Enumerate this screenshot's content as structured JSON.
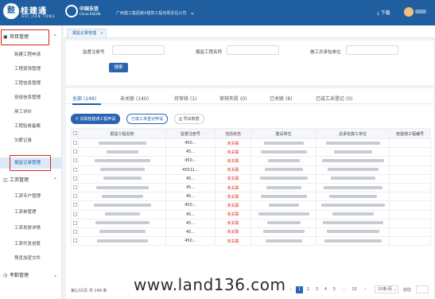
{
  "header": {
    "logo_mark": "鼓",
    "logo_title": "桂建通",
    "logo_subtitle": "GUI JIAN TONG",
    "partner_title": "中国东信",
    "partner_subtitle": "China-ASEAN",
    "org_selector": "广西建工集团第X建筑工程有限责任公司",
    "download_label": "下载"
  },
  "sidebar": {
    "groups": [
      {
        "label": "项目管理",
        "items": [
          "新建工程申请",
          "工程现场管理",
          "工程信息管理",
          "班组信息管理",
          "用工评价",
          "工程验收备案",
          "欠薪记录",
          "报监记录管理"
        ]
      },
      {
        "label": "工资管理",
        "items": [
          "工资专户管理",
          "工资单管理",
          "工资发放详情",
          "工资代发进度",
          "预览加密文件"
        ]
      },
      {
        "label": "考勤管理",
        "items": []
      }
    ],
    "active_item": "报监记录管理"
  },
  "tabs": [
    {
      "label": "报监记录管理"
    }
  ],
  "filter": {
    "fields": [
      {
        "label": "监督注册号",
        "value": ""
      },
      {
        "label": "报监工程名称",
        "value": ""
      },
      {
        "label": "施工总承包单位",
        "value": ""
      }
    ],
    "search_label": "搜索"
  },
  "status_tabs": [
    {
      "label": "全部",
      "count": "(149)"
    },
    {
      "label": "未关联",
      "count": "(140)"
    },
    {
      "label": "待审核",
      "count": "(1)"
    },
    {
      "label": "审核失败",
      "count": "(0)"
    },
    {
      "label": "已关联",
      "count": "(8)"
    },
    {
      "label": "已竣工未登记",
      "count": "(0)"
    }
  ],
  "actions": {
    "link_label": "关联桂建通工程申请",
    "register_label": "已竣工未登记申请",
    "export_label": "导出数据"
  },
  "table": {
    "columns": [
      "报监工程名称",
      "监督注册号",
      "当前状态",
      "建设单位",
      "总承包施工单位",
      "桂建通工程编号"
    ],
    "rows": [
      {
        "reg": "450…",
        "status": "未关联"
      },
      {
        "reg": "45…",
        "status": "未关联"
      },
      {
        "reg": "450…",
        "status": "未关联"
      },
      {
        "reg": "45011…",
        "status": "未关联"
      },
      {
        "reg": "45…",
        "status": "未关联"
      },
      {
        "reg": "45…",
        "status": "未关联"
      },
      {
        "reg": "45…",
        "status": "未关联"
      },
      {
        "reg": "450…",
        "status": "未关联"
      },
      {
        "reg": "45…",
        "status": "未关联"
      },
      {
        "reg": "45…",
        "status": "未关联"
      },
      {
        "reg": "45…",
        "status": "未关联"
      },
      {
        "reg": "450…",
        "status": "未关联"
      }
    ]
  },
  "pagination": {
    "total_text": "第1/15页 共 149 条",
    "pages": [
      "1",
      "2",
      "3",
      "4",
      "5",
      "…",
      "15"
    ],
    "current": "1",
    "page_size": "10条/页",
    "jump_label": "前往"
  },
  "watermark": "www.land136.com",
  "colors": {
    "brand": "#1f5fa0",
    "danger": "#e0302a",
    "highlight_box": "#d9231f"
  }
}
